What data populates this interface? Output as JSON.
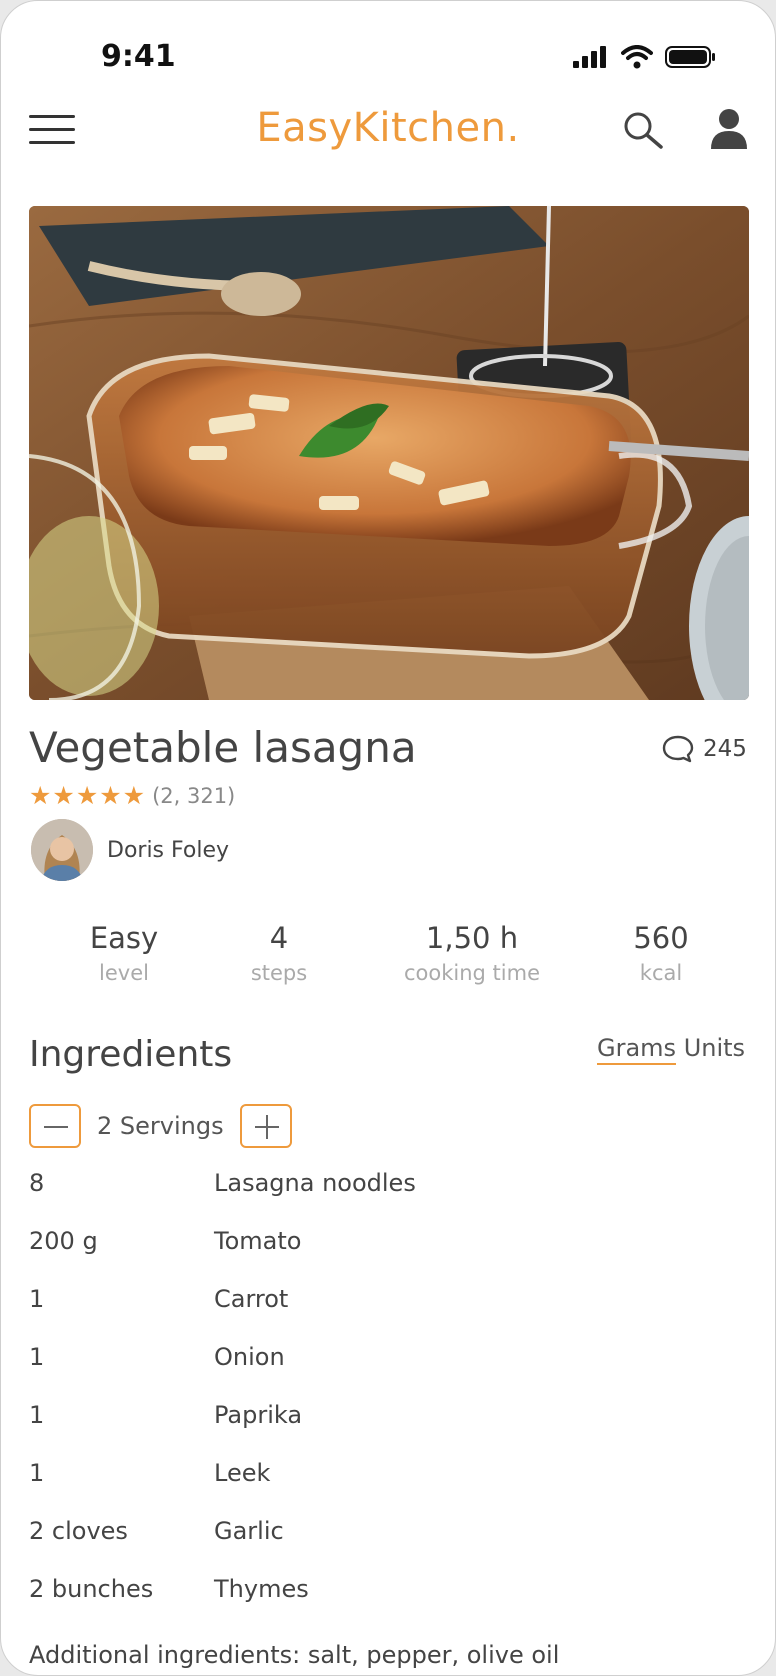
{
  "status_bar": {
    "time": "9:41"
  },
  "header": {
    "logo_part1": "Easy",
    "logo_part2": "Kitchen.",
    "accent_color": "#ee9a3c"
  },
  "recipe": {
    "title": "Vegetable lasagna",
    "comment_count": "245",
    "stars": "★★★★★",
    "rating_value": 5,
    "rating_count": "(2, 321)",
    "author": "Doris Foley"
  },
  "stats": [
    {
      "value": "Easy",
      "label": "level"
    },
    {
      "value": "4",
      "label": "steps"
    },
    {
      "value": "1,50 h",
      "label": "cooking time"
    },
    {
      "value": "560",
      "label": "kcal"
    }
  ],
  "ingredients": {
    "title": "Ingredients",
    "units_grams": "Grams",
    "units_units": "Units",
    "servings": "2 Servings",
    "items": [
      {
        "qty": "8",
        "name": "Lasagna noodles"
      },
      {
        "qty": "200 g",
        "name": "Tomato"
      },
      {
        "qty": "1",
        "name": "Carrot"
      },
      {
        "qty": "1",
        "name": "Onion"
      },
      {
        "qty": "1",
        "name": "Paprika"
      },
      {
        "qty": "1",
        "name": "Leek"
      },
      {
        "qty": "2 cloves",
        "name": "Garlic"
      },
      {
        "qty": "2 bunches",
        "name": "Thymes"
      }
    ],
    "additional": "Additional ingredients: salt, pepper, olive oil"
  }
}
